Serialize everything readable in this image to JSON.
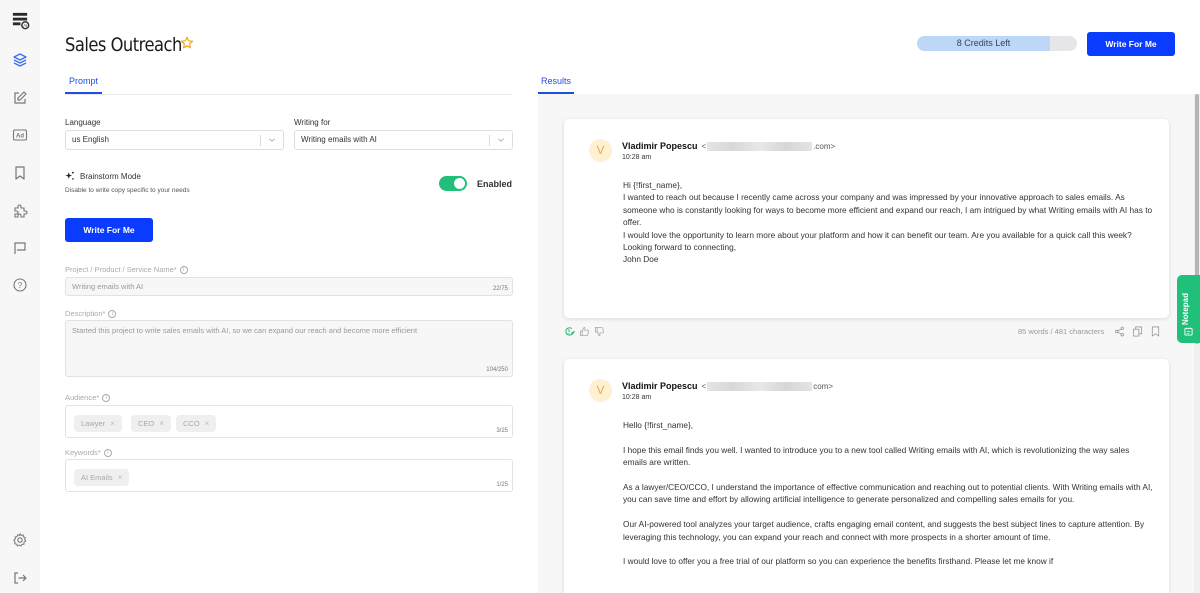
{
  "sidebar": {
    "items": [
      {
        "icon": "logo-icon"
      },
      {
        "icon": "layers-icon",
        "active": true
      },
      {
        "icon": "edit-icon"
      },
      {
        "icon": "ad-icon",
        "label": "Ad"
      },
      {
        "icon": "bookmark-icon"
      },
      {
        "icon": "puzzle-icon"
      },
      {
        "icon": "flag-icon"
      },
      {
        "icon": "help-icon",
        "label": "?"
      },
      {
        "icon": "settings-icon"
      },
      {
        "icon": "logout-icon"
      }
    ]
  },
  "header": {
    "title": "Sales Outreach",
    "credits_label": "8 Credits Left",
    "credits_fraction": 0.83,
    "write_button": "Write For Me"
  },
  "tabs": {
    "prompt": "Prompt",
    "results": "Results"
  },
  "form": {
    "language_label": "Language",
    "language_value": "us English",
    "writing_for_label": "Writing for",
    "writing_for_value": "Writing emails with AI",
    "brainstorm_title": "Brainstorm Mode",
    "brainstorm_sub": "Disable to write copy specific to your needs",
    "brainstorm_enabled": true,
    "brainstorm_state": "Enabled",
    "write_button": "Write For Me",
    "project_label": "Project / Product / Service Name*",
    "project_value": "Writing emails with AI",
    "project_count": "22/75",
    "description_label": "Description*",
    "description_value": "Started this project to write sales emails with AI, so we can expand our reach and become more efficient",
    "description_count": "104/250",
    "audience_label": "Audience*",
    "audience_chips": [
      "Lawyer",
      "CEO",
      "CCO"
    ],
    "audience_count": "3/25",
    "keywords_label": "Keywords*",
    "keyword_chips": [
      "AI Emails"
    ],
    "keywords_count": "1/25",
    "info_glyph": "i",
    "chip_remove": "×"
  },
  "results": [
    {
      "avatar": "V",
      "sender": "Vladimir Popescu",
      "email_prefix": "<",
      "email_suffix": ".com>",
      "time": "10:28 am",
      "paragraphs": [
        "Hi {!first_name},",
        "I wanted to reach out because I recently came across your company and was impressed by your innovative approach to sales emails. As someone who is constantly looking for ways to become more efficient and expand our reach, I am intrigued by what Writing emails with AI has to offer.",
        "I would love the opportunity to learn more about your platform and how it can benefit our team. Are you available for a quick call this week?",
        "Looking forward to connecting,",
        "John Doe"
      ],
      "stats": "85 words / 481 characters"
    },
    {
      "avatar": "V",
      "sender": "Vladimir Popescu",
      "email_prefix": "<",
      "email_suffix": "com>",
      "time": "10:28 am",
      "paragraphs": [
        "Hello {!first_name},",
        "I hope this email finds you well. I wanted to introduce you to a new tool called Writing emails with AI, which is revolutionizing the way sales emails are written.",
        "As a lawyer/CEO/CCO, I understand the importance of effective communication and reaching out to potential clients. With Writing emails with AI, you can save time and effort by allowing artificial intelligence to generate personalized and compelling sales emails for you.",
        "Our AI-powered tool analyzes your target audience, crafts engaging email content, and suggests the best subject lines to capture attention. By leveraging this technology, you can expand your reach and connect with more prospects in a shorter amount of time.",
        "I would love to offer you a free trial of our platform so you can experience the benefits firsthand. Please let me know if"
      ]
    }
  ],
  "notepad": {
    "label": "Notepad"
  },
  "colors": {
    "accent": "#0a3cff",
    "tab_active": "#1d4fe0",
    "toggle_on": "#20bf7a",
    "credits_fill": "#bcd7f8",
    "star": "#f2a91e",
    "avatar_bg": "#fdf1d2"
  }
}
